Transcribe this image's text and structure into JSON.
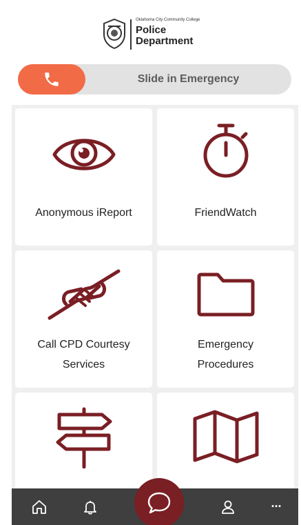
{
  "header": {
    "logo_small": "Oklahoma City Community College",
    "logo_line1": "Police",
    "logo_line2": "Department"
  },
  "emergency_slider": {
    "label": "Slide in Emergency",
    "icon": "phone-icon"
  },
  "tiles": [
    {
      "label": "Anonymous iReport",
      "icon": "eye-icon"
    },
    {
      "label": "FriendWatch",
      "icon": "stopwatch-icon"
    },
    {
      "label_line1": "Call CPD Courtesy",
      "label_line2": "Services",
      "icon": "handshake-icon"
    },
    {
      "label_line1": "Emergency",
      "label_line2": "Procedures",
      "icon": "folder-icon"
    },
    {
      "label": "",
      "icon": "signpost-icon"
    },
    {
      "label": "",
      "icon": "map-icon"
    }
  ],
  "bottom_nav": {
    "items": [
      "home-icon",
      "bell-icon",
      "chat-icon",
      "user-icon",
      "more-icon"
    ],
    "more_glyph": "···"
  },
  "colors": {
    "accent": "#7a1f24",
    "emergency": "#f26b47",
    "nav_bg": "#3f3f3f",
    "page_bg": "#efefef"
  }
}
